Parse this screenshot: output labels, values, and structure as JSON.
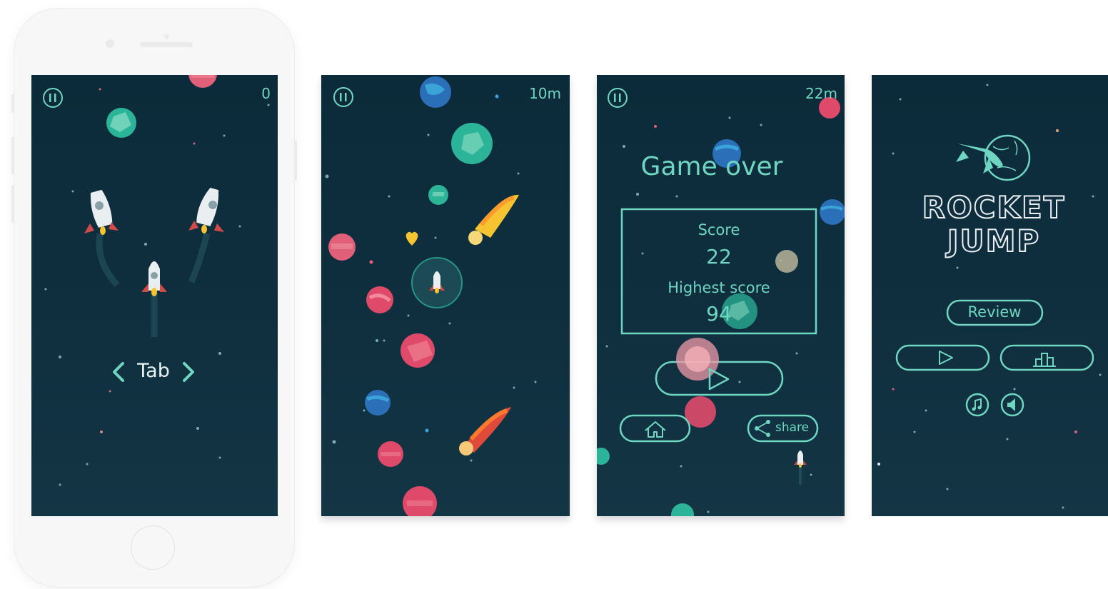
{
  "screens": {
    "s1": {
      "score": "0",
      "hint": "Tab"
    },
    "s2": {
      "distance": "10m"
    },
    "s3": {
      "distance": "22m",
      "title": "Game over",
      "score_label": "Score",
      "score_value": "22",
      "high_label": "Highest score",
      "high_value": "94",
      "share_label": "share"
    },
    "s4": {
      "logo_line1": "ROCKET",
      "logo_line2": "JUMP",
      "review_label": "Review"
    }
  },
  "colors": {
    "bg": "#0f2f3f",
    "accent": "#6fd6c2"
  }
}
